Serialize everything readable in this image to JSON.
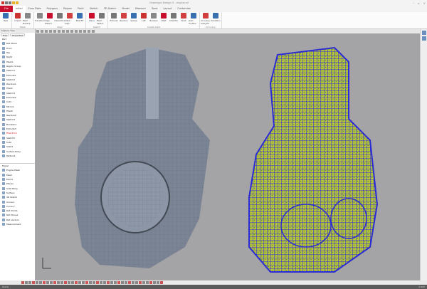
{
  "title_bar": {
    "title": "Geomagic Design X - engine.xrl",
    "controls": [
      "–",
      "▫",
      "×"
    ]
  },
  "tabs": [
    "File",
    "Initial",
    "Scan Data",
    "Polygons",
    "Region",
    "Point",
    "Sketch",
    "3D Sketch",
    "Model",
    "Measure",
    "Tools",
    "Layout",
    "Customize"
  ],
  "ribbon": {
    "groups": [
      {
        "label": "",
        "buttons": [
          "New"
        ]
      },
      {
        "label": "Mesh",
        "buttons": [
          "Import",
          "Mesh Buildup"
        ]
      },
      {
        "label": "Align",
        "buttons": [
          "Transform",
          "Align Wizard",
          "Interactive",
          "Initial Align",
          "Best Fit"
        ]
      },
      {
        "label": "Sketch",
        "buttons": [
          "Plane",
          "Mesh Sketch"
        ]
      },
      {
        "label": "Create Solid",
        "buttons": [
          "Extrude",
          "Revolve",
          "Sweep",
          "Loft",
          "Boolean",
          "Fillet",
          "Chamfer",
          "Shell",
          "Auto Surface"
        ]
      },
      {
        "label": "Accuracy",
        "buttons": [
          "Accuracy Analyzer",
          "Deviation"
        ]
      }
    ]
  },
  "tree": {
    "header": "Feature Tree",
    "tabs": [
      "Tree",
      "Properties"
    ],
    "root": "Part",
    "items": [
      "Ref. Plane",
      "Front",
      "Top",
      "Right",
      "Mesh1",
      "Region Group",
      "Sketch1",
      "Extrude1",
      "Sketch2",
      "Revolve1",
      "Fillet1",
      "Sketch3",
      "Extrude2",
      "Cut1",
      "Mirror1",
      "Fillet2",
      "Revolve2",
      "Sketch4",
      "Boolean1",
      "Extrude3",
      "Fillet Error",
      "Sketch5",
      "Cut2",
      "Shell1",
      "Surface Body",
      "Pattern1"
    ],
    "error_item": "Fillet Error",
    "model_header": "Model",
    "model_items": [
      "Engine Mesh",
      "Mesh",
      "Points",
      "Planes",
      "Solid Body",
      "Surface",
      "3D Sketch",
      "Curve 1",
      "Curve 2",
      "Ref. Points",
      "Ref. Planes",
      "Ref. Vectors",
      "Measurement"
    ]
  },
  "status": {
    "left": "Ready",
    "right": "0.000"
  },
  "colors": {
    "accent": "#c8102e",
    "viewport": "#a4a4a6",
    "mesh": "#7a8494",
    "wire_blue": "#2a2ad6",
    "wire_yellow": "#b8c23a"
  }
}
